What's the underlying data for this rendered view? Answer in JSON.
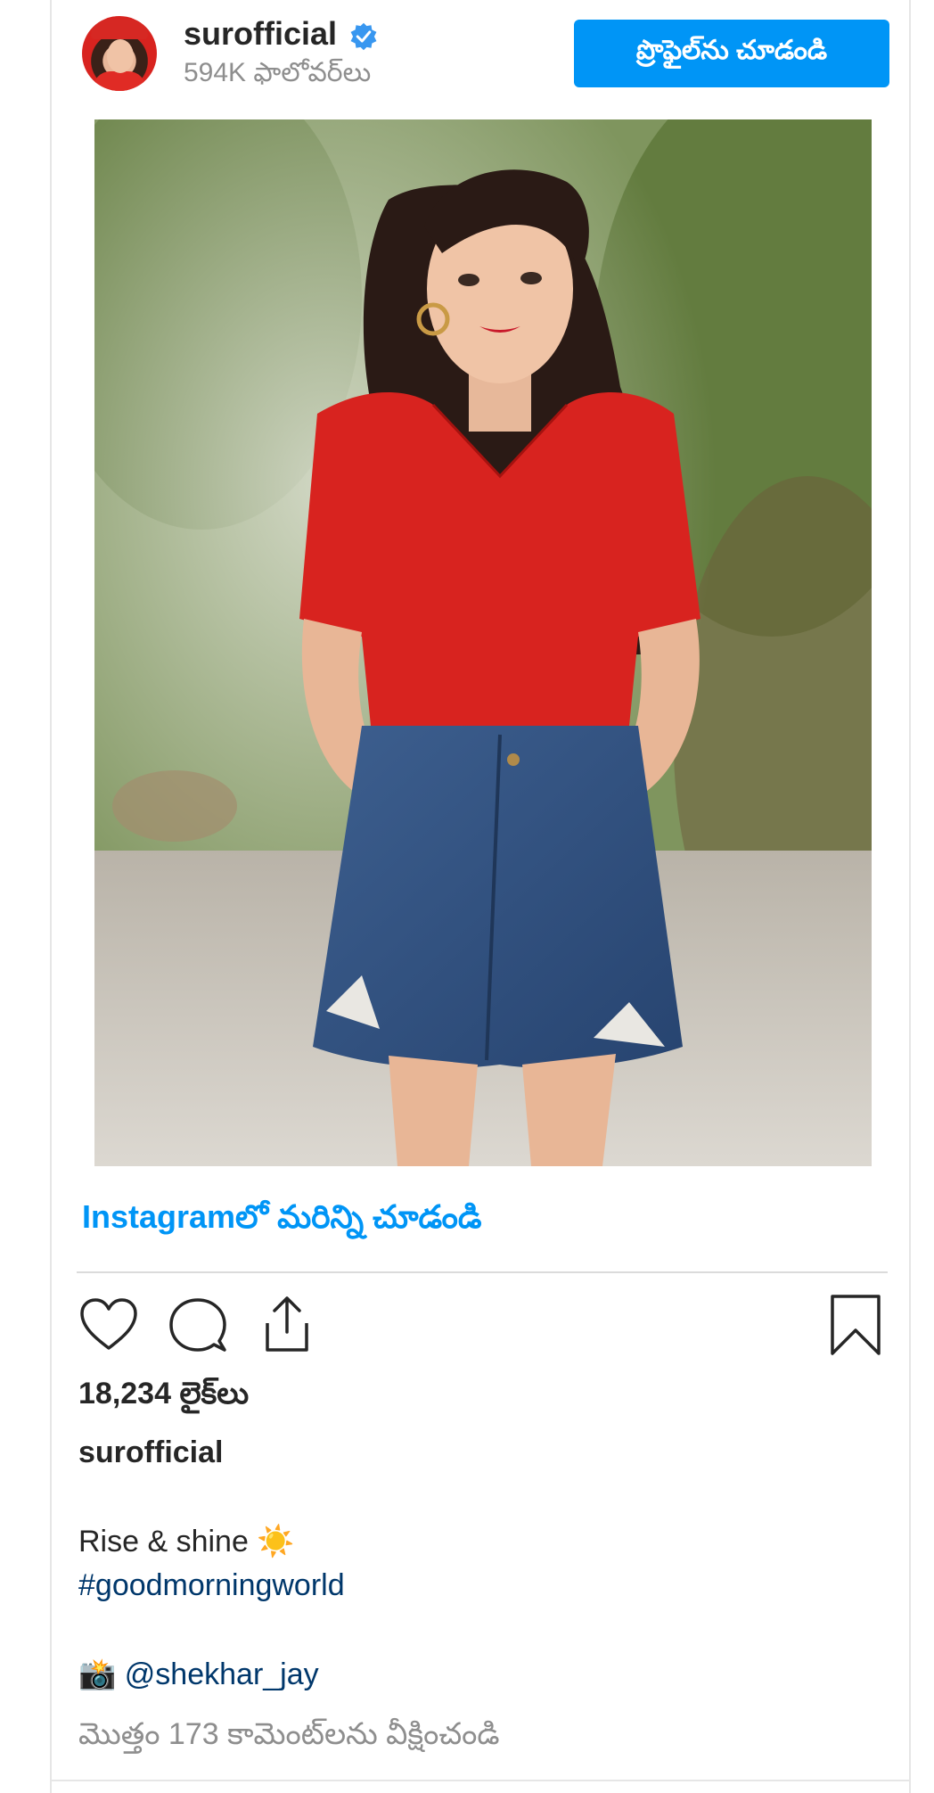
{
  "header": {
    "username": "surofficial",
    "followers": "594K ఫాలోవర్‌లు",
    "view_profile_label": "ప్రొఫైల్‌ను చూడండి",
    "verified_icon": "verified-badge-icon",
    "verified_color": "#3897f0"
  },
  "post": {
    "image_alt": "Woman in red top and denim skirt standing among green foliage",
    "more_on_instagram": "Instagramలో మరిన్ని చూడండి"
  },
  "actions": {
    "like_icon": "heart-icon",
    "comment_icon": "comment-bubble-icon",
    "share_icon": "share-upload-icon",
    "save_icon": "bookmark-icon"
  },
  "stats": {
    "likes": "18,234 లైక్‌లు"
  },
  "caption": {
    "username": "surofficial",
    "line1_text": "Rise & shine ",
    "line1_emoji": "☀️",
    "hashtag": "#goodmorningworld",
    "credit_emoji": "📸",
    "mention": "@shekhar_jay"
  },
  "comments": {
    "view_all": "మొత్తం 173 కామెంట్‌లను వీక్షించండి"
  },
  "colors": {
    "accent": "#0095f6",
    "text": "#262626",
    "muted": "#8e8e8e",
    "link_dark": "#00376b"
  }
}
